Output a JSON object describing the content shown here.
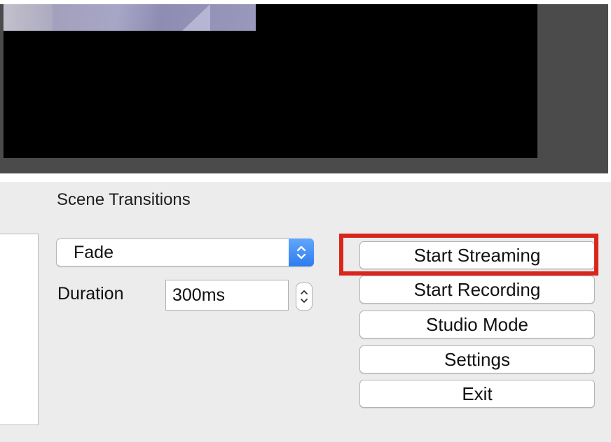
{
  "transitions": {
    "title": "Scene Transitions",
    "dropdown": {
      "selected": "Fade"
    },
    "duration": {
      "label": "Duration",
      "value": "300ms"
    }
  },
  "controls": {
    "start_streaming": "Start Streaming",
    "start_recording": "Start Recording",
    "studio_mode": "Studio Mode",
    "settings": "Settings",
    "exit": "Exit"
  },
  "colors": {
    "highlight": "#d9261b",
    "dropdown_accent": "#2d7cf0"
  }
}
